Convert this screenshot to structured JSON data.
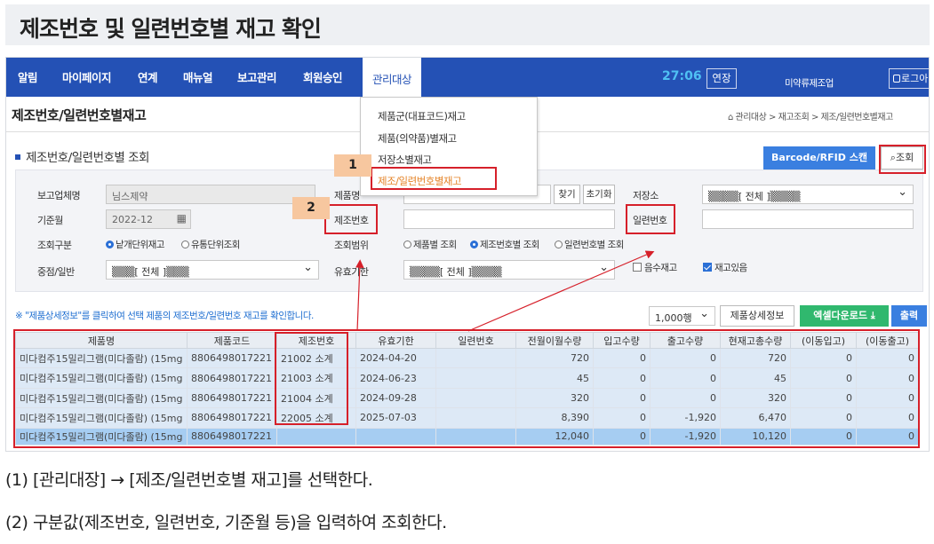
{
  "header": {
    "title": "제조번호 및 일련번호별 재고 확인"
  },
  "nav": {
    "items": [
      "알림",
      "마이페이지",
      "연계",
      "매뉴얼",
      "보고관리",
      "회원승인",
      "관리대상"
    ],
    "timer": "27:06",
    "extend": "연장",
    "user": "미약류제조업",
    "logout": "로그아"
  },
  "dropdown": {
    "items": [
      "제품군(대표코드)재고",
      "제품(의약품)별재고",
      "저장소별재고",
      "제조/일련번호별재고"
    ]
  },
  "page": {
    "title": "제조번호/일련번호별재고",
    "breadcrumb": "관리대상 > 재고조회 > 제조/일련번호별재고",
    "section_title": "제조번호/일련번호별 조회",
    "barcode_button": "Barcode/RFID 스캔",
    "search_button": "조회"
  },
  "form": {
    "company_label": "보고업체명",
    "company_value": "님스제약",
    "base_month_label": "기준월",
    "base_month_value": "2022-12",
    "type_label": "조회구분",
    "type_opt1": "낱개단위재고",
    "type_opt2": "유통단위조회",
    "class_label": "중점/일반",
    "class_value": "▒▒▒[ 전체 ]▒▒▒",
    "product_label": "제품명",
    "find_button": "찾기",
    "reset_button": "초기화",
    "storage_label": "저장소",
    "storage_value": "▒▒▒▒[ 전체 ]▒▒▒▒",
    "mfg_label": "제조번호",
    "serial_label": "일련번호",
    "range_label": "조회범위",
    "range_opt1": "제품별 조회",
    "range_opt2": "제조번호별 조회",
    "range_opt3": "일련번호별 조회",
    "expiry_label": "유효기한",
    "expiry_value": "▒▒▒▒[ 전체 ]▒▒▒▒",
    "negative_label": "음수재고",
    "instock_label": "재고있음"
  },
  "note": "※ \"제품상세정보\"를 클릭하여 선택 제품의 제조번호/일련번호 재고를 확인합니다.",
  "toolbar": {
    "rows": "1,000행",
    "detail": "제품상세정보",
    "excel": "엑셀다운로드",
    "print": "출력"
  },
  "table": {
    "headers": [
      "제품명",
      "제품코드",
      "제조번호",
      "유효기한",
      "일련번호",
      "전월이월수량",
      "입고수량",
      "출고수량",
      "현재고총수량",
      "(이동입고)",
      "(이동출고)"
    ],
    "rows": [
      [
        "미다컴주15밀리그램(미다졸람) (15mg",
        "8806498017221",
        "21002 소계",
        "2024-04-20",
        "",
        "720",
        "0",
        "0",
        "720",
        "0",
        "0"
      ],
      [
        "미다컴주15밀리그램(미다졸람) (15mg",
        "8806498017221",
        "21003 소계",
        "2024-06-23",
        "",
        "45",
        "0",
        "0",
        "45",
        "0",
        "0"
      ],
      [
        "미다컴주15밀리그램(미다졸람) (15mg",
        "8806498017221",
        "21004 소계",
        "2024-09-28",
        "",
        "320",
        "0",
        "0",
        "320",
        "0",
        "0"
      ],
      [
        "미다컴주15밀리그램(미다졸람) (15mg",
        "8806498017221",
        "22005 소계",
        "2025-07-03",
        "",
        "8,390",
        "0",
        "-1,920",
        "6,470",
        "0",
        "0"
      ]
    ],
    "total": [
      "미다컴주15밀리그램(미다졸람) (15mg",
      "8806498017221",
      "",
      "",
      "",
      "12,040",
      "0",
      "-1,920",
      "10,120",
      "0",
      "0"
    ]
  },
  "badges": {
    "one": "1",
    "two": "2"
  },
  "captions": {
    "step1": "(1) [관리대장] → [제조/일련번호별 재고]를 선택한다.",
    "step2": "(2) 구분값(제조번호, 일련번호, 기준월 등)을 입력하여 조회한다."
  },
  "colors": {
    "nav": "#2451b5",
    "accent_red": "#d6202a",
    "badge": "#f7c79f",
    "excel": "#30b86e"
  }
}
